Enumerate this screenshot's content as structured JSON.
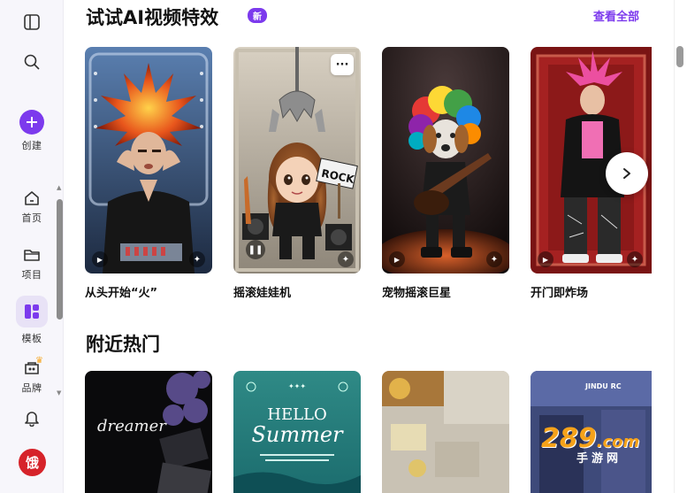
{
  "sidebar": {
    "items": [
      {
        "label": "创建"
      },
      {
        "label": "首页"
      },
      {
        "label": "项目"
      },
      {
        "label": "模板"
      },
      {
        "label": "品牌"
      }
    ],
    "avatar_text": "饿"
  },
  "effects": {
    "title": "试试AI视频特效",
    "badge": "新",
    "view_all": "查看全部",
    "cards": [
      {
        "title": "从头开始“火”"
      },
      {
        "title": "摇滚娃娃机"
      },
      {
        "title": "宠物摇滚巨星"
      },
      {
        "title": "开门即炸场"
      }
    ],
    "sign_text": "ROCK"
  },
  "nearby": {
    "title": "附近热门",
    "cards": [
      {
        "caption": "dreamer"
      },
      {
        "caption_top": "HELLO",
        "caption_bottom": "Summer"
      },
      {
        "caption": ""
      },
      {
        "caption": "JINDU RC"
      }
    ]
  },
  "watermark": {
    "number": "289",
    "suffix": ".com",
    "sub": "手游网"
  },
  "colors": {
    "accent": "#7c3aed",
    "avatar": "#d6232a"
  }
}
